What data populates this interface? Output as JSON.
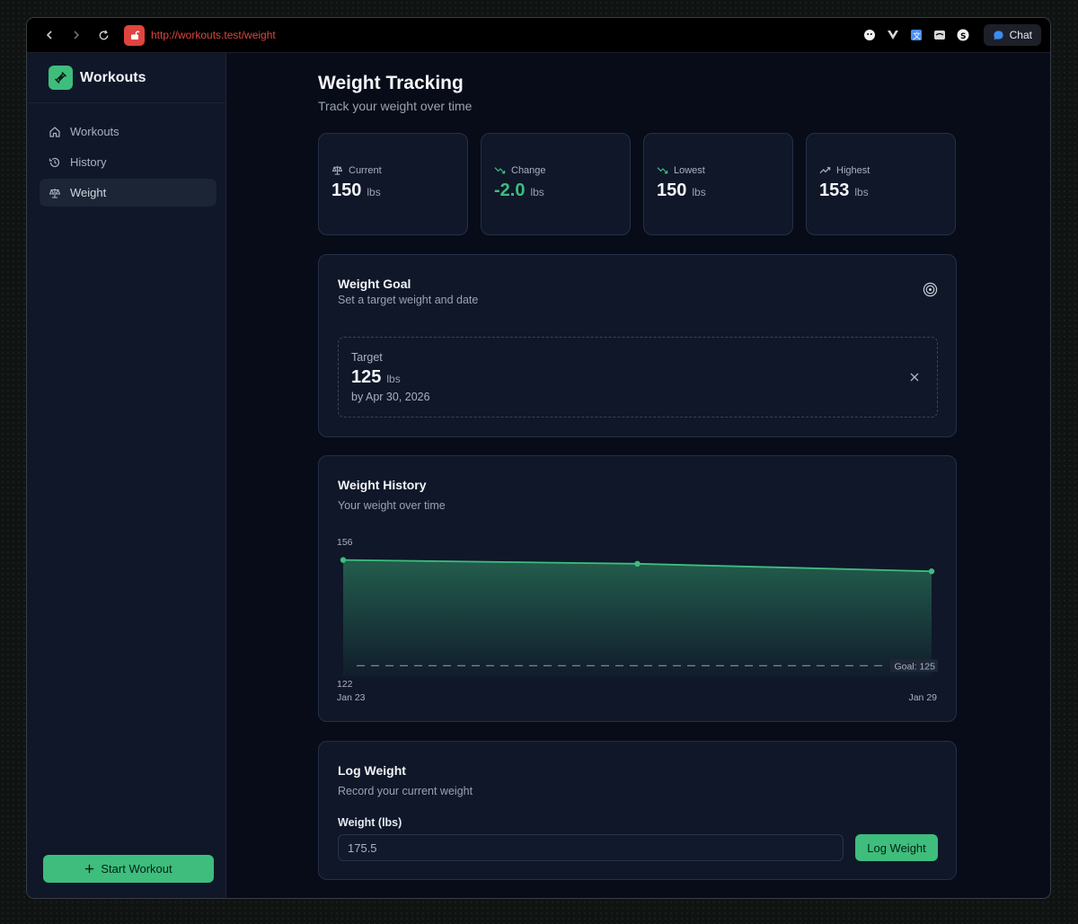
{
  "browser": {
    "url": "http://workouts.test/weight",
    "chat_label": "Chat"
  },
  "sidebar": {
    "brand": "Workouts",
    "items": [
      {
        "label": "Workouts",
        "icon": "home-icon"
      },
      {
        "label": "History",
        "icon": "history-icon"
      },
      {
        "label": "Weight",
        "icon": "scale-icon",
        "active": true
      }
    ],
    "start_button": "Start Workout"
  },
  "page": {
    "title": "Weight Tracking",
    "subtitle": "Track your weight over time"
  },
  "stats": [
    {
      "label": "Current",
      "value": "150",
      "unit": "lbs",
      "icon": "scale-icon"
    },
    {
      "label": "Change",
      "value": "-2.0",
      "unit": "lbs",
      "icon": "trend-down-icon"
    },
    {
      "label": "Lowest",
      "value": "150",
      "unit": "lbs",
      "icon": "trend-down-icon"
    },
    {
      "label": "Highest",
      "value": "153",
      "unit": "lbs",
      "icon": "trend-up-icon"
    }
  ],
  "goal": {
    "title": "Weight Goal",
    "subtitle": "Set a target weight and date",
    "target_label": "Target",
    "target_value": "125",
    "target_unit": "lbs",
    "target_date": "by Apr 30, 2026"
  },
  "history": {
    "title": "Weight History",
    "subtitle": "Your weight over time"
  },
  "chart_data": {
    "type": "area",
    "x": [
      "Jan 23",
      "",
      "Jan 29"
    ],
    "x_tick_labels": [
      "Jan 23",
      "Jan 29"
    ],
    "values": [
      153,
      152,
      150
    ],
    "ylim": [
      122,
      156
    ],
    "y_tick_labels": [
      "156",
      "122"
    ],
    "goal_line": 125,
    "goal_label": "Goal: 125",
    "line_color": "#3ebd7d"
  },
  "log": {
    "title": "Log Weight",
    "subtitle": "Record your current weight",
    "field_label": "Weight (lbs)",
    "field_value": "175.5",
    "button": "Log Weight"
  },
  "colors": {
    "accent": "#3ebd7d",
    "url_red": "#e0443e"
  }
}
